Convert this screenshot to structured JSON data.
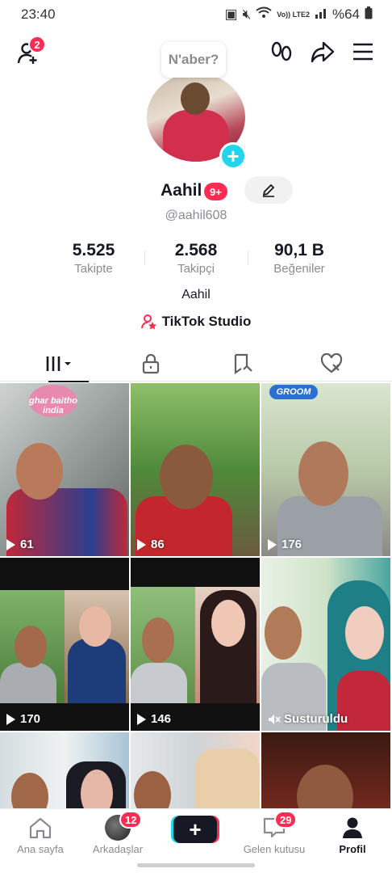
{
  "status_bar": {
    "time": "23:40",
    "network": "Vo)) LTE2",
    "battery": "%64"
  },
  "header": {
    "friend_request_count": "2"
  },
  "profile": {
    "status_bubble": "N'aber?",
    "name": "Aahil",
    "name_badge": "9+",
    "handle": "@aahil608",
    "bio": "Aahil",
    "studio_link": "TikTok Studio"
  },
  "stats": [
    {
      "value": "5.525",
      "label": "Takipte"
    },
    {
      "value": "2.568",
      "label": "Takipçi"
    },
    {
      "value": "90,1 B",
      "label": "Beğeniler"
    }
  ],
  "tabs": [
    "videos-tab",
    "private-tab",
    "reposts-tab",
    "liked-tab"
  ],
  "videos": [
    {
      "views": "61",
      "sticker": "ghar baitho india"
    },
    {
      "views": "86"
    },
    {
      "views": "176",
      "sticker": "GROOM"
    },
    {
      "views": "170"
    },
    {
      "views": "146"
    },
    {
      "views": "Susturuldu",
      "muted": true
    },
    {
      "views": ""
    },
    {
      "views": ""
    },
    {
      "views": ""
    }
  ],
  "bottom_nav": {
    "home": "Ana sayfa",
    "friends": "Arkadaşlar",
    "friends_badge": "12",
    "inbox": "Gelen kutusu",
    "inbox_badge": "29",
    "profile": "Profil"
  },
  "colors": {
    "accent": "#fe2c55",
    "cyan": "#20d5ec",
    "text": "#161823",
    "muted": "#8a8b91"
  }
}
